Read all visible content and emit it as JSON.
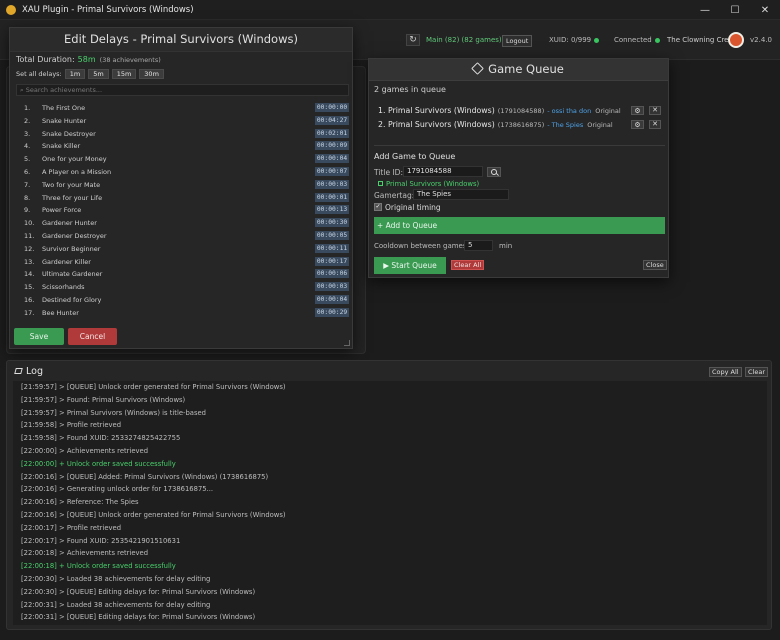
{
  "window": {
    "title": "XAU Plugin - Primal Survivors (Windows)",
    "controls": [
      "—",
      "☐",
      "✕"
    ]
  },
  "topbar": {
    "refresh_glyph": "↻",
    "main": "Main (82) (82 games)",
    "logout": "Logout",
    "xuid": "XUID: 0/999",
    "connected": "Connected",
    "gamertag": "The Clowning Crew",
    "version": "v2.4.0",
    "status_color": "#39c660"
  },
  "edit_delays": {
    "title": "Edit Delays - Primal Survivors (Windows)",
    "total_label": "Total Duration:",
    "total_value": "58m",
    "total_count": "(38 achievements)",
    "set_all_label": "Set all delays:",
    "presets": [
      "1m",
      "5m",
      "15m",
      "30m"
    ],
    "search_placeholder": "Search achievements...",
    "search_glyph": "⌕",
    "items": [
      {
        "num": "1.",
        "name": "The First One",
        "time": "00:00:00"
      },
      {
        "num": "2.",
        "name": "Snake Hunter",
        "time": "00:04:27"
      },
      {
        "num": "3.",
        "name": "Snake Destroyer",
        "time": "00:02:01"
      },
      {
        "num": "4.",
        "name": "Snake Killer",
        "time": "00:00:09"
      },
      {
        "num": "5.",
        "name": "One for your Money",
        "time": "00:00:04"
      },
      {
        "num": "6.",
        "name": "A Player on a Mission",
        "time": "00:00:07"
      },
      {
        "num": "7.",
        "name": "Two for your Mate",
        "time": "00:00:03"
      },
      {
        "num": "8.",
        "name": "Three for your Life",
        "time": "00:00:01"
      },
      {
        "num": "9.",
        "name": "Power Force",
        "time": "00:00:13"
      },
      {
        "num": "10.",
        "name": "Gardener Hunter",
        "time": "00:00:30"
      },
      {
        "num": "11.",
        "name": "Gardener Destroyer",
        "time": "00:00:05"
      },
      {
        "num": "12.",
        "name": "Survivor Beginner",
        "time": "00:00:11"
      },
      {
        "num": "13.",
        "name": "Gardener Killer",
        "time": "00:00:17"
      },
      {
        "num": "14.",
        "name": "Ultimate Gardener",
        "time": "00:00:06"
      },
      {
        "num": "15.",
        "name": "Scissorhands",
        "time": "00:00:03"
      },
      {
        "num": "16.",
        "name": "Destined for Glory",
        "time": "00:00:04"
      },
      {
        "num": "17.",
        "name": "Bee Hunter",
        "time": "00:00:29"
      }
    ],
    "save": "Save",
    "cancel": "Cancel"
  },
  "queue": {
    "title": "Game Queue",
    "count_text": "2 games in queue",
    "items": [
      {
        "num": "1.",
        "name": "Primal Survivors (Windows)",
        "id": "(1791084588)",
        "gamertag": "- ossi tha don",
        "mode": "Original"
      },
      {
        "num": "2.",
        "name": "Primal Survivors (Windows)",
        "id": "(1738616875)",
        "gamertag": "- The Spies",
        "mode": "Original"
      }
    ],
    "gear_glyph": "⚙",
    "remove_glyph": "✕",
    "add_title": "Add Game to Queue",
    "title_id_label": "Title ID:",
    "title_id_value": "1791084588",
    "found": "Primal Survivors (Windows)",
    "gamertag_label": "Gamertag:",
    "gamertag_value": "The Spies",
    "check_glyph": "✓",
    "original_timing": "Original timing",
    "add_button": "+ Add to Queue",
    "cooldown_label": "Cooldown between games:",
    "cooldown_value": "5",
    "cooldown_unit": "min",
    "start": "▶ Start Queue",
    "clear_all": "Clear All",
    "close": "Close"
  },
  "log": {
    "title": "Log",
    "copy_all": "Copy All",
    "clear": "Clear",
    "lines": [
      {
        "text": "[21:59:57] > [QUEUE] Unlock order generated for Primal Survivors (Windows)",
        "ok": false
      },
      {
        "text": "[21:59:57] > Found: Primal Survivors (Windows)",
        "ok": false
      },
      {
        "text": "[21:59:57] > Primal Survivors (Windows) is title-based",
        "ok": false
      },
      {
        "text": "[21:59:58] > Profile retrieved",
        "ok": false
      },
      {
        "text": "[21:59:58] > Found XUID: 2533274825422755",
        "ok": false
      },
      {
        "text": "[22:00:00] > Achievements retrieved",
        "ok": false
      },
      {
        "text": "[22:00:00] + Unlock order saved successfully",
        "ok": true
      },
      {
        "text": "[22:00:16] > [QUEUE] Added: Primal Survivors (Windows) (1738616875)",
        "ok": false
      },
      {
        "text": "[22:00:16] > Generating unlock order for 1738616875...",
        "ok": false
      },
      {
        "text": "[22:00:16] > Reference: The Spies",
        "ok": false
      },
      {
        "text": "[22:00:16] > [QUEUE] Unlock order generated for Primal Survivors (Windows)",
        "ok": false
      },
      {
        "text": "[22:00:17] > Profile retrieved",
        "ok": false
      },
      {
        "text": "[22:00:17] > Found XUID: 2535421901510631",
        "ok": false
      },
      {
        "text": "[22:00:18] > Achievements retrieved",
        "ok": false
      },
      {
        "text": "[22:00:18] + Unlock order saved successfully",
        "ok": true
      },
      {
        "text": "[22:00:30] > Loaded 38 achievements for delay editing",
        "ok": false
      },
      {
        "text": "[22:00:30] > [QUEUE] Editing delays for: Primal Survivors (Windows)",
        "ok": false
      },
      {
        "text": "[22:00:31] > Loaded 38 achievements for delay editing",
        "ok": false
      },
      {
        "text": "[22:00:31] > [QUEUE] Editing delays for: Primal Survivors (Windows)",
        "ok": false
      }
    ]
  }
}
